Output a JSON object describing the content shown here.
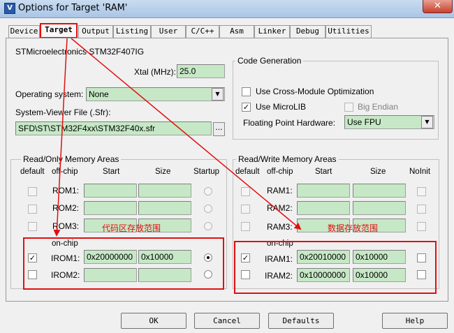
{
  "window": {
    "title": "Options for Target 'RAM'",
    "close_glyph": "✕",
    "icon_name": "uvision-icon"
  },
  "tabs": [
    {
      "label": "Device",
      "active": false
    },
    {
      "label": "Target",
      "active": true
    },
    {
      "label": "Output",
      "active": false
    },
    {
      "label": "Listing",
      "active": false
    },
    {
      "label": "User",
      "active": false
    },
    {
      "label": "C/C++",
      "active": false
    },
    {
      "label": "Asm",
      "active": false
    },
    {
      "label": "Linker",
      "active": false
    },
    {
      "label": "Debug",
      "active": false
    },
    {
      "label": "Utilities",
      "active": false
    }
  ],
  "target": {
    "device_name": "STMicroelectronics STM32F407IG",
    "xtal_label": "Xtal (MHz):",
    "xtal_value": "25.0",
    "os_label": "Operating system:",
    "os_value": "None",
    "sfr_label": "System-Viewer File (.Sfr):",
    "sfr_value": "SFD\\ST\\STM32F4xx\\STM32F40x.sfr",
    "browse_label": "..."
  },
  "code_generation": {
    "title": "Code Generation",
    "cross_module_label": "Use Cross-Module Optimization",
    "cross_module_checked": false,
    "microlib_label": "Use MicroLIB",
    "microlib_checked": true,
    "big_endian_label": "Big Endian",
    "big_endian_checked": false,
    "fp_label": "Floating Point Hardware:",
    "fp_value": "Use FPU"
  },
  "ro_memory": {
    "title": "Read/Only Memory Areas",
    "headers": {
      "default": "default",
      "offchip": "off-chip",
      "start": "Start",
      "size": "Size",
      "startup": "Startup"
    },
    "onchip_label": "on-chip",
    "rows": [
      {
        "name": "ROM1:",
        "start": "",
        "size": "",
        "default": false,
        "startup": false
      },
      {
        "name": "ROM2:",
        "start": "",
        "size": "",
        "default": false,
        "startup": false
      },
      {
        "name": "ROM3:",
        "start": "",
        "size": "",
        "default": false,
        "startup": false
      },
      {
        "name": "IROM1:",
        "start": "0x20000000",
        "size": "0x10000",
        "default": true,
        "startup": true
      },
      {
        "name": "IROM2:",
        "start": "",
        "size": "",
        "default": false,
        "startup": false
      }
    ]
  },
  "rw_memory": {
    "title": "Read/Write Memory Areas",
    "headers": {
      "default": "default",
      "offchip": "off-chip",
      "start": "Start",
      "size": "Size",
      "noinit": "NoInit"
    },
    "onchip_label": "on-chip",
    "rows": [
      {
        "name": "RAM1:",
        "start": "",
        "size": "",
        "default": false,
        "noinit": false
      },
      {
        "name": "RAM2:",
        "start": "",
        "size": "",
        "default": false,
        "noinit": false
      },
      {
        "name": "RAM3:",
        "start": "",
        "size": "",
        "default": false,
        "noinit": false
      },
      {
        "name": "IRAM1:",
        "start": "0x20010000",
        "size": "0x10000",
        "default": true,
        "noinit": false
      },
      {
        "name": "IRAM2:",
        "start": "0x10000000",
        "size": "0x10000",
        "default": false,
        "noinit": false
      }
    ]
  },
  "annotations": {
    "code_area": "代码区存放范围",
    "data_area": "数据存放范围",
    "color": "#e01010"
  },
  "buttons": {
    "ok": "OK",
    "cancel": "Cancel",
    "defaults": "Defaults",
    "help": "Help"
  },
  "colors": {
    "field_bg": "#c6e8c6",
    "dialog_bg": "#f0f0f0"
  }
}
